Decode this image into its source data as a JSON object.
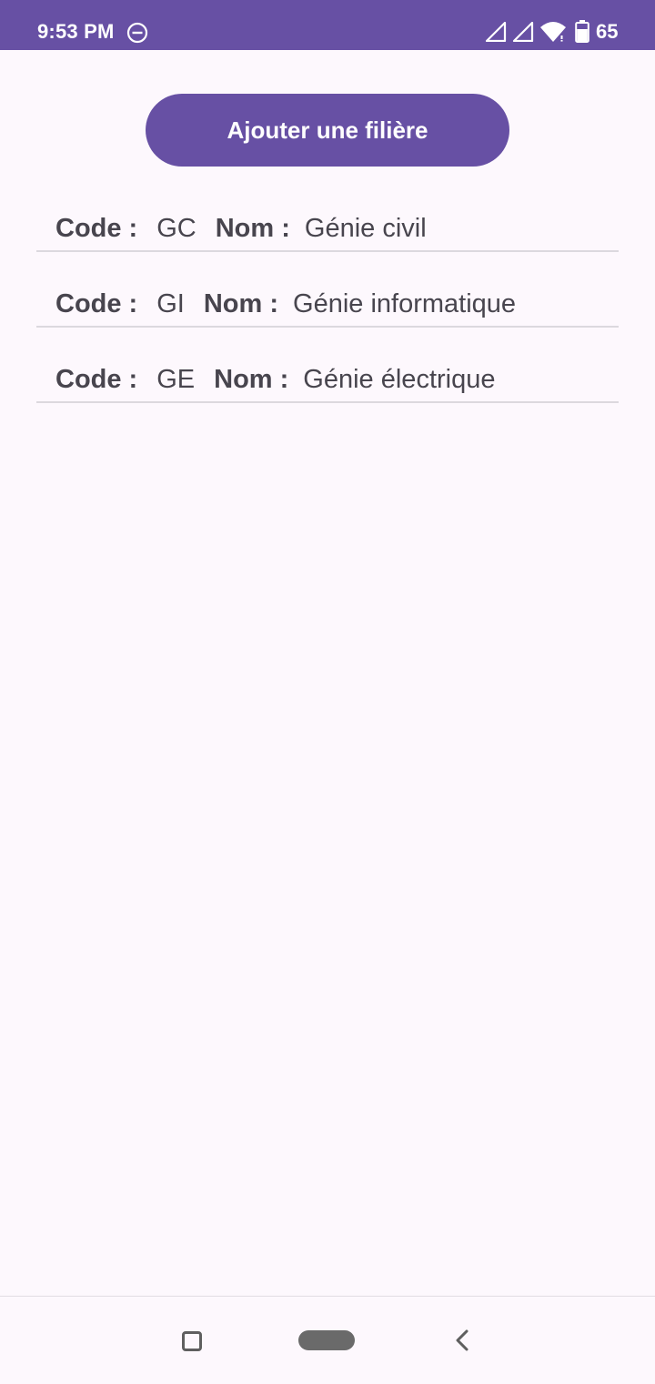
{
  "status_bar": {
    "time": "9:53 PM",
    "battery_level": "65",
    "icons": [
      "do-not-disturb-icon",
      "signal-icon",
      "signal-icon",
      "wifi-icon",
      "battery-icon"
    ]
  },
  "toolbar": {
    "add_label": "Ajouter une filière"
  },
  "labels": {
    "code": "Code :",
    "nom": "Nom :"
  },
  "filieres": [
    {
      "code": "GC",
      "nom": "Génie civil"
    },
    {
      "code": "GI",
      "nom": "Génie informatique"
    },
    {
      "code": "GE",
      "nom": "Génie électrique"
    }
  ],
  "colors": {
    "accent": "#6750a4",
    "background": "#fdf8fd",
    "text": "#48454e",
    "divider": "#dcd8de"
  }
}
